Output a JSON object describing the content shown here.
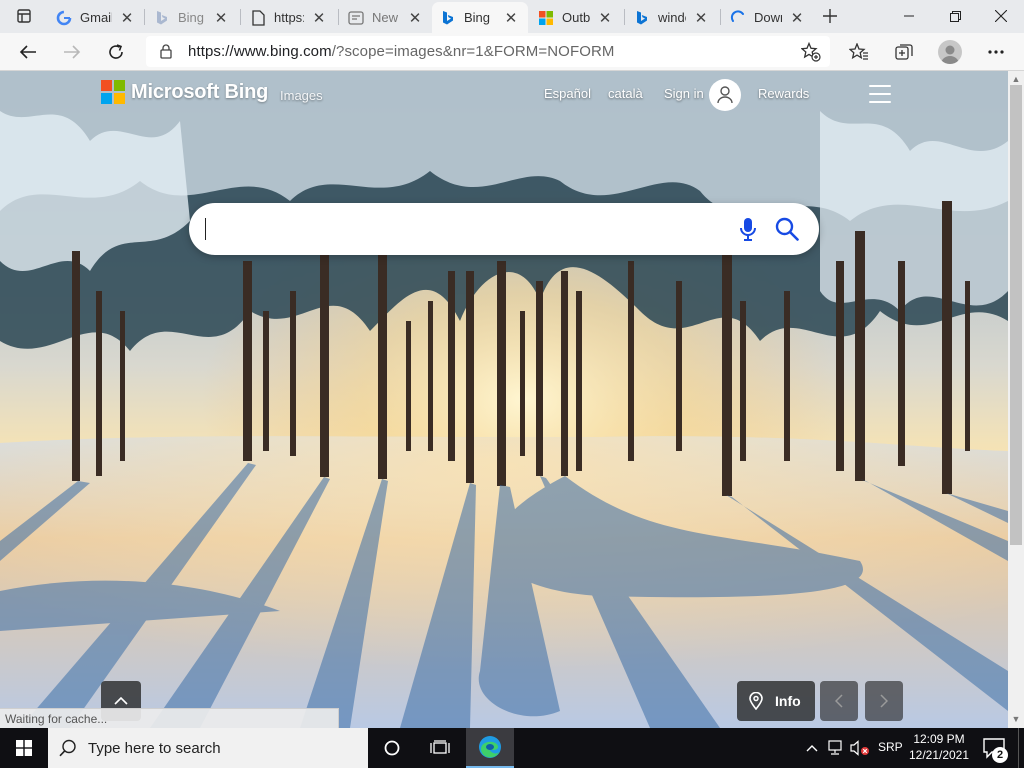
{
  "browser": {
    "tabs": [
      {
        "title": "Gmail",
        "icon": "google-icon",
        "active": false
      },
      {
        "title": "Bing",
        "icon": "bing-icon",
        "active": false
      },
      {
        "title": "https:",
        "icon": "document-icon",
        "active": false
      },
      {
        "title": "New",
        "icon": "new-tab-page-icon",
        "active": false
      },
      {
        "title": "Bing",
        "icon": "bing-icon",
        "active": true
      },
      {
        "title": "Outb",
        "icon": "microsoft-icon",
        "active": false
      },
      {
        "title": "windo",
        "icon": "bing-icon",
        "active": false
      },
      {
        "title": "Dowr",
        "icon": "loading-icon",
        "active": false
      }
    ],
    "address": {
      "host": "https://www.bing.com",
      "path": "/?scope=images&nr=1&FORM=NOFORM"
    }
  },
  "bing": {
    "brand": "Microsoft Bing",
    "nav_images": "Images",
    "links": {
      "espanol": "Español",
      "catala": "català",
      "sign_in": "Sign in",
      "rewards": "Rewards"
    },
    "search": {
      "value": ""
    },
    "info_label": "Info",
    "status_text": "Waiting for cache...",
    "logo_colors": [
      "#f25022",
      "#7fba00",
      "#00a4ef",
      "#ffb900"
    ],
    "accent": "#174ae4"
  },
  "taskbar": {
    "search_placeholder": "Type here to search",
    "language": "SRP",
    "time": "12:09 PM",
    "date": "12/21/2021",
    "notification_count": "2"
  }
}
